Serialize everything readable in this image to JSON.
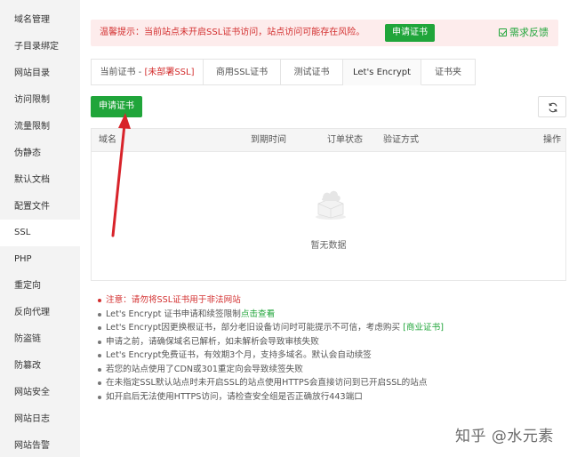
{
  "sidebar": {
    "items": [
      {
        "label": "域名管理"
      },
      {
        "label": "子目录绑定"
      },
      {
        "label": "网站目录"
      },
      {
        "label": "访问限制"
      },
      {
        "label": "流量限制"
      },
      {
        "label": "伪静态"
      },
      {
        "label": "默认文档"
      },
      {
        "label": "配置文件"
      },
      {
        "label": "SSL"
      },
      {
        "label": "PHP"
      },
      {
        "label": "重定向"
      },
      {
        "label": "反向代理"
      },
      {
        "label": "防盗链"
      },
      {
        "label": "防篡改"
      },
      {
        "label": "网站安全"
      },
      {
        "label": "网站日志"
      },
      {
        "label": "网站告警"
      }
    ],
    "active": "SSL"
  },
  "warning": {
    "text": "温馨提示：当前站点未开启SSL证书访问，站点访问可能存在风险。",
    "button": "申请证书",
    "feedback": "需求反馈"
  },
  "tabs": [
    {
      "label": "当前证书 - ",
      "suffix": "[未部署SSL]"
    },
    {
      "label": "商用SSL证书",
      "suffix": ""
    },
    {
      "label": "测试证书",
      "suffix": ""
    },
    {
      "label": "Let's Encrypt",
      "suffix": ""
    },
    {
      "label": "证书夹",
      "suffix": ""
    }
  ],
  "active_tab": "Let's Encrypt",
  "toolbar": {
    "apply_button": "申请证书"
  },
  "table": {
    "columns": [
      "域名",
      "到期时间",
      "订单状态",
      "验证方式",
      "操作"
    ],
    "empty_text": "暂无数据"
  },
  "notes": {
    "n0": "注意：请勿将SSL证书用于非法网站",
    "n1_a": "Let's Encrypt 证书申请和续签限制",
    "n1_b": "点击查看",
    "n2_a": "Let's Encrypt因更换根证书，部分老旧设备访问时可能提示不可信，考虑购买",
    "n2_b": "[商业证书]",
    "n3": "申请之前，请确保域名已解析，如未解析会导致审核失败",
    "n4": "Let's Encrypt免费证书，有效期3个月，支持多域名。默认会自动续签",
    "n5": "若您的站点使用了CDN或301重定向会导致续签失败",
    "n6": "在未指定SSL默认站点时未开启SSL的站点使用HTTPS会直接访问到已开启SSL的站点",
    "n7": "如开启后无法使用HTTPS访问，请检查安全组是否正确放行443端口"
  },
  "watermark": "知乎 @水元素",
  "colors": {
    "accent_green": "#20a53a",
    "warning_red": "#d32f2f",
    "annotation_arrow": "#d8232a"
  },
  "icons": {
    "refresh": "refresh-icon",
    "feedback": "checkbox-icon",
    "empty": "empty-box-icon"
  }
}
